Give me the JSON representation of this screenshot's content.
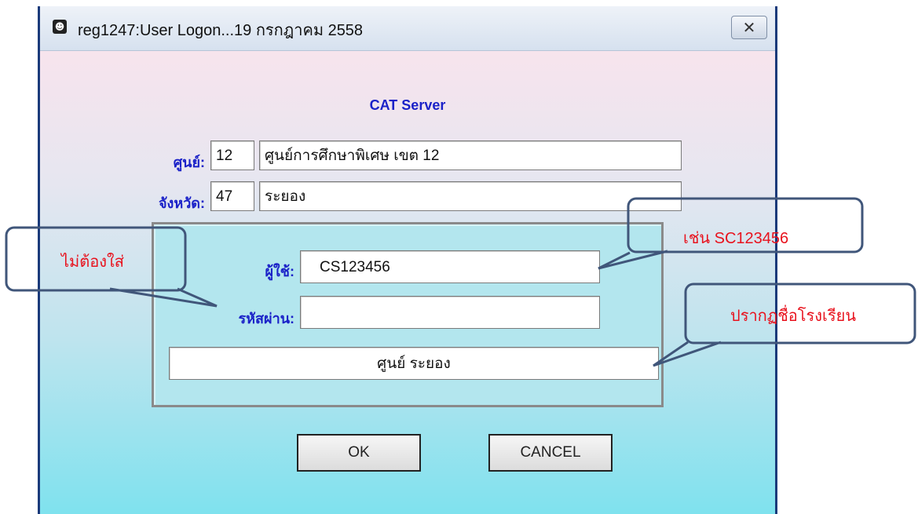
{
  "window": {
    "title": "reg1247:User Logon...19 กรกฎาคม 2558",
    "close_label": "✕"
  },
  "server_title": "CAT Server",
  "center": {
    "label": "ศูนย์:",
    "code": "12",
    "name": "ศูนย์การศึกษาพิเศษ เขต 12"
  },
  "province": {
    "label": "จังหวัด:",
    "code": "47",
    "name": "ระยอง"
  },
  "login": {
    "user_label": "ผู้ใช้:",
    "user_value": "CS123456",
    "password_label": "รหัสผ่าน:",
    "password_value": "",
    "school_display": "ศูนย์ ระยอง"
  },
  "buttons": {
    "ok": "OK",
    "cancel": "CANCEL"
  },
  "annotations": {
    "no_password": "ไม่ต้องใส่",
    "user_example": "เช่น SC123456",
    "school_appears": "ปรากฏชื่อโรงเรียน",
    "color": "#e8121d"
  }
}
